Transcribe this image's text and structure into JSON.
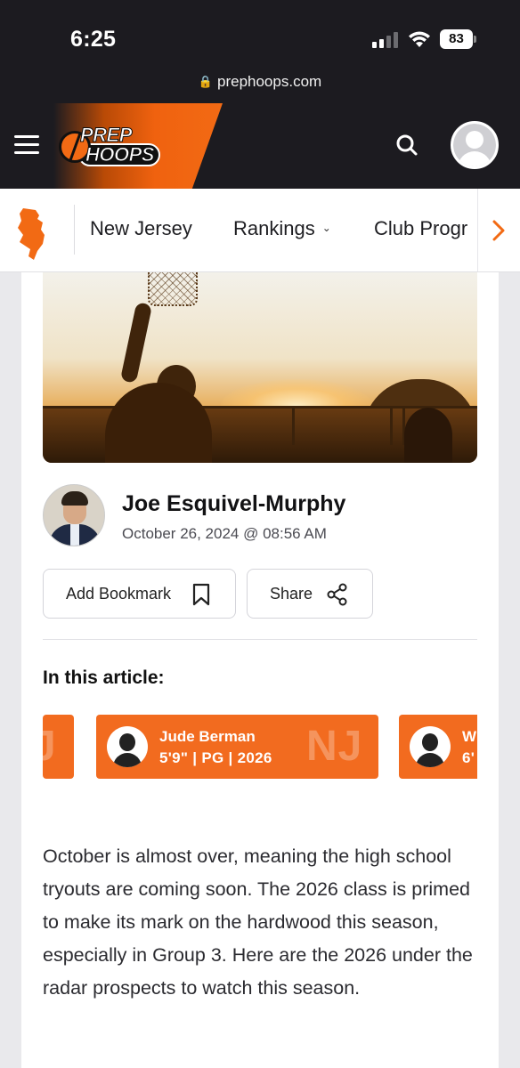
{
  "status_bar": {
    "time": "6:25",
    "battery": "83",
    "url": "prephoops.com"
  },
  "header": {
    "logo_line1": "PREP",
    "logo_line2": "HOOPS",
    "brand_color": "#f26a14",
    "icons": [
      "menu-icon",
      "search-icon",
      "user-avatar-icon"
    ]
  },
  "subnav": {
    "state_icon": "new-jersey-state-icon",
    "items": [
      {
        "label": "New Jersey"
      },
      {
        "label": "Rankings",
        "has_dropdown": true
      },
      {
        "label": "Club Progr"
      }
    ]
  },
  "article": {
    "author_name": "Joe Esquivel-Murphy",
    "date": "October 26, 2024 @ 08:56 AM",
    "bookmark_label": "Add Bookmark",
    "share_label": "Share",
    "in_article_title": "In this article:",
    "players": [
      {
        "name": "",
        "meta": "",
        "state": "J"
      },
      {
        "name": "Jude Berman",
        "meta": "5'9\" | PG | 2026",
        "state": "NJ"
      },
      {
        "name": "W",
        "meta": "6'",
        "state": ""
      }
    ],
    "body": "October is almost over, meaning the high school tryouts are coming soon. The 2026 class is primed to make its mark on the hardwood this season, especially in Group 3. Here are the 2026 under the radar prospects to watch this season."
  }
}
